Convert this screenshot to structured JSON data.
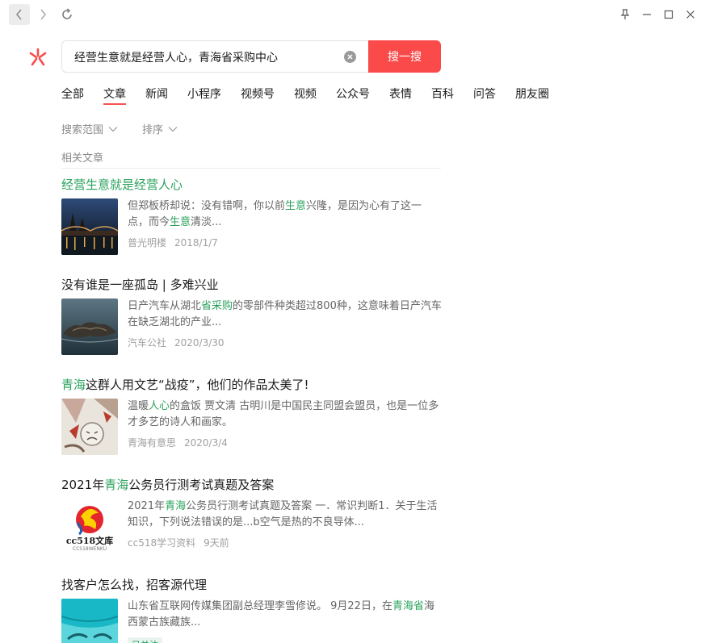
{
  "search": {
    "query": "经营生意就是经营人心，青海省采购中心",
    "button_label": "搜一搜"
  },
  "tabs": [
    "全部",
    "文章",
    "新闻",
    "小程序",
    "视频号",
    "视频",
    "公众号",
    "表情",
    "百科",
    "问答",
    "朋友圈"
  ],
  "active_tab": "文章",
  "filters": [
    "搜索范围",
    "排序"
  ],
  "section_label": "相关文章",
  "results": [
    {
      "title_parts": [
        {
          "t": "经营生意就是经营人心",
          "h": true
        }
      ],
      "desc_parts": [
        {
          "t": "但郑板桥却说：没有错啊，你以前",
          "h": false
        },
        {
          "t": "生意",
          "h": true
        },
        {
          "t": "兴隆，是因为心有了这一点，而今",
          "h": false
        },
        {
          "t": "生意",
          "h": true
        },
        {
          "t": "清淡...",
          "h": false
        }
      ],
      "source": "普光明楼",
      "date": "2018/1/7",
      "thumb": "night-city"
    },
    {
      "title_parts": [
        {
          "t": "没有谁是一座孤岛 | 多难兴业",
          "h": false
        }
      ],
      "desc_parts": [
        {
          "t": "日产汽车从湖北",
          "h": false
        },
        {
          "t": "省采购",
          "h": true
        },
        {
          "t": "的零部件种类超过800种，这意味着日产汽车在缺乏湖北的产业...",
          "h": false
        }
      ],
      "source": "汽车公社",
      "date": "2020/3/30",
      "thumb": "island"
    },
    {
      "title_parts": [
        {
          "t": "青海",
          "h": true
        },
        {
          "t": "这群人用文艺“战疫”，他们的作品太美了!",
          "h": false
        }
      ],
      "desc_parts": [
        {
          "t": "温暖",
          "h": false
        },
        {
          "t": "人心",
          "h": true
        },
        {
          "t": "的盒饭 贾文清 古明川是中国民主同盟会盟员，也是一位多才多艺的诗人和画家。",
          "h": false
        }
      ],
      "source": "青海有意思",
      "date": "2020/3/4",
      "thumb": "painting"
    },
    {
      "title_parts": [
        {
          "t": "2021年",
          "h": false
        },
        {
          "t": "青海",
          "h": true
        },
        {
          "t": "公务员行测考试真题及答案",
          "h": false
        }
      ],
      "desc_parts": [
        {
          "t": "2021年",
          "h": false
        },
        {
          "t": "青海",
          "h": true
        },
        {
          "t": "公务员行测考试真题及答案 一．常识判断1．关于生活知识，下列说法错误的是...b空气是热的不良导体...",
          "h": false
        }
      ],
      "source": "cc518学习资料",
      "date": "9天前",
      "thumb": "cc518",
      "thumb_text": "cc518文库",
      "thumb_subtext": "CCS18WENKU"
    },
    {
      "title_parts": [
        {
          "t": "找客户怎么找，招客源代理",
          "h": false
        }
      ],
      "desc_parts": [
        {
          "t": "山东省互联网传媒集团副总经理李雪修说。 9月22日，在",
          "h": false
        },
        {
          "t": "青海",
          "h": true
        },
        {
          "t": "省",
          "h": true
        },
        {
          "t": "海西蒙古族藏族...",
          "h": false
        }
      ],
      "source": "",
      "date": "",
      "thumb": "cyan-hat",
      "tag": "已关注"
    }
  ]
}
